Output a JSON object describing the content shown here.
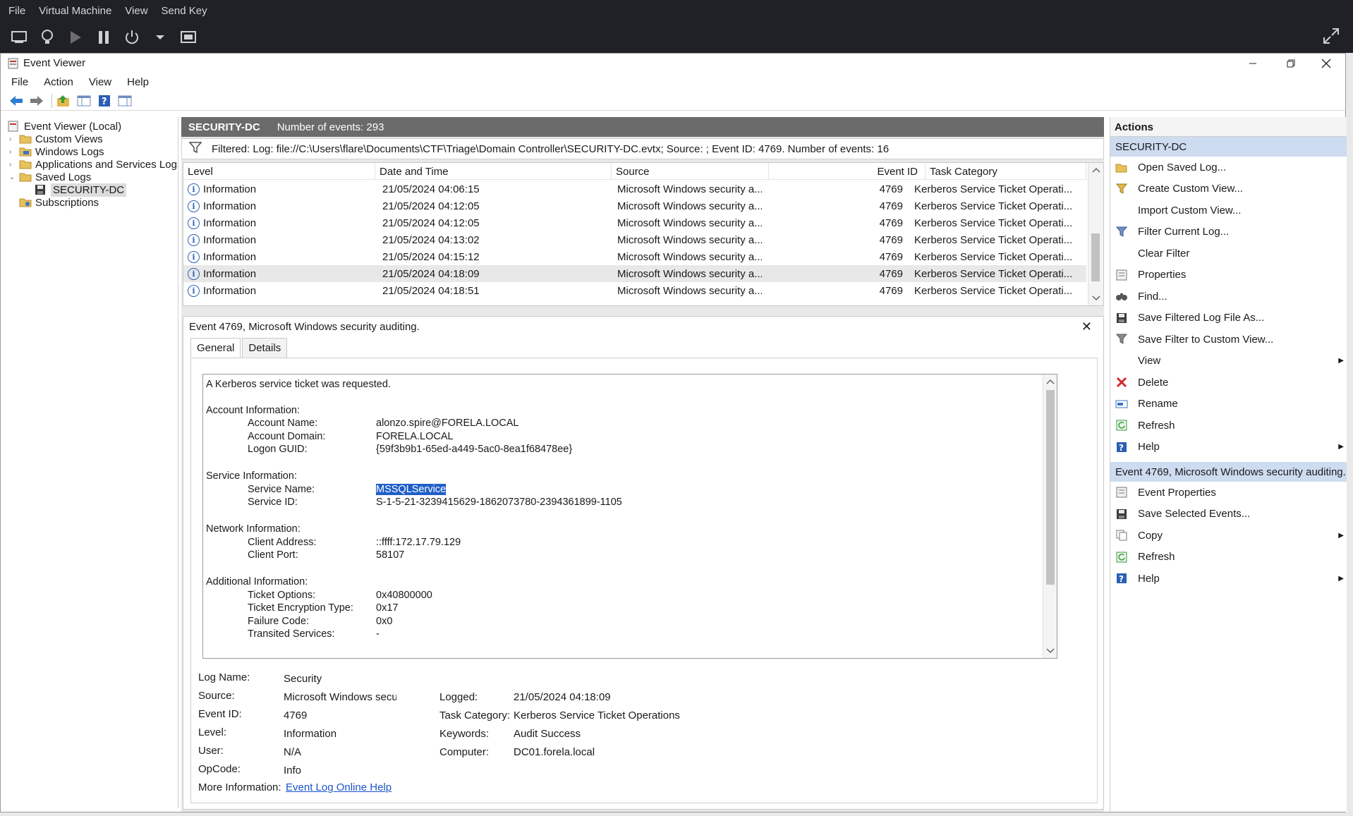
{
  "vm": {
    "menu": [
      "File",
      "Virtual Machine",
      "View",
      "Send Key"
    ]
  },
  "window": {
    "title": "Event Viewer",
    "menu": [
      "File",
      "Action",
      "View",
      "Help"
    ]
  },
  "tree": {
    "items": [
      {
        "label": "Event Viewer (Local)"
      },
      {
        "label": "Custom Views"
      },
      {
        "label": "Windows Logs"
      },
      {
        "label": "Applications and Services Logs"
      },
      {
        "label": "Saved Logs"
      },
      {
        "label": "SECURITY-DC"
      },
      {
        "label": "Subscriptions"
      }
    ]
  },
  "pane": {
    "name": "SECURITY-DC",
    "count": "Number of events: 293",
    "filter": "Filtered: Log: file://C:\\Users\\flare\\Documents\\CTF\\Triage\\Domain Controller\\SECURITY-DC.evtx; Source: ; Event ID: 4769. Number of events: 16"
  },
  "grid": {
    "columns": [
      "Level",
      "Date and Time",
      "Source",
      "Event ID",
      "Task Category"
    ],
    "rows": [
      {
        "level": "Information",
        "date": "21/05/2024 04:06:15",
        "source": "Microsoft Windows security a...",
        "id": "4769",
        "cat": "Kerberos Service Ticket Operati..."
      },
      {
        "level": "Information",
        "date": "21/05/2024 04:12:05",
        "source": "Microsoft Windows security a...",
        "id": "4769",
        "cat": "Kerberos Service Ticket Operati..."
      },
      {
        "level": "Information",
        "date": "21/05/2024 04:12:05",
        "source": "Microsoft Windows security a...",
        "id": "4769",
        "cat": "Kerberos Service Ticket Operati..."
      },
      {
        "level": "Information",
        "date": "21/05/2024 04:13:02",
        "source": "Microsoft Windows security a...",
        "id": "4769",
        "cat": "Kerberos Service Ticket Operati..."
      },
      {
        "level": "Information",
        "date": "21/05/2024 04:15:12",
        "source": "Microsoft Windows security a...",
        "id": "4769",
        "cat": "Kerberos Service Ticket Operati..."
      },
      {
        "level": "Information",
        "date": "21/05/2024 04:18:09",
        "source": "Microsoft Windows security a...",
        "id": "4769",
        "cat": "Kerberos Service Ticket Operati..."
      },
      {
        "level": "Information",
        "date": "21/05/2024 04:18:51",
        "source": "Microsoft Windows security a...",
        "id": "4769",
        "cat": "Kerberos Service Ticket Operati..."
      }
    ]
  },
  "detail": {
    "title": "Event 4769, Microsoft Windows security auditing.",
    "tabs": [
      "General",
      "Details"
    ],
    "message": {
      "intro": "A Kerberos service ticket was requested.",
      "account_header": "Account Information:",
      "account_name_label": "Account Name:",
      "account_name": "alonzo.spire@FORELA.LOCAL",
      "account_domain_label": "Account Domain:",
      "account_domain": "FORELA.LOCAL",
      "logon_guid_label": "Logon GUID:",
      "logon_guid": "{59f3b9b1-65ed-a449-5ac0-8ea1f68478ee}",
      "service_header": "Service Information:",
      "service_name_label": "Service Name:",
      "service_name": "MSSQLService",
      "service_id_label": "Service ID:",
      "service_id": "S-1-5-21-3239415629-1862073780-2394361899-1105",
      "network_header": "Network Information:",
      "client_address_label": "Client Address:",
      "client_address": "::ffff:172.17.79.129",
      "client_port_label": "Client Port:",
      "client_port": "58107",
      "additional_header": "Additional Information:",
      "ticket_options_label": "Ticket Options:",
      "ticket_options": "0x40800000",
      "ticket_enc_label": "Ticket Encryption Type:",
      "ticket_enc": "0x17",
      "failure_code_label": "Failure Code:",
      "failure_code": "0x0",
      "transited_label": "Transited Services:",
      "transited": "-"
    },
    "props": {
      "log_name_label": "Log Name:",
      "log_name": "Security",
      "source_label": "Source:",
      "source": "Microsoft Windows security a",
      "event_id_label": "Event ID:",
      "event_id": "4769",
      "level_label": "Level:",
      "level": "Information",
      "user_label": "User:",
      "user": "N/A",
      "opcode_label": "OpCode:",
      "opcode": "Info",
      "more_info_label": "More Information:",
      "more_info": "Event Log Online Help",
      "logged_label": "Logged:",
      "logged": "21/05/2024 04:18:09",
      "task_cat_label": "Task Category:",
      "task_cat": "Kerberos Service Ticket Operations",
      "keywords_label": "Keywords:",
      "keywords": "Audit Success",
      "computer_label": "Computer:",
      "computer": "DC01.forela.local"
    }
  },
  "actions": {
    "header": "Actions",
    "section1": "SECURITY-DC",
    "items1": [
      {
        "label": "Open Saved Log...",
        "icon": "open-folder-icon"
      },
      {
        "label": "Create Custom View...",
        "icon": "filter-create-icon"
      },
      {
        "label": "Import Custom View...",
        "icon": ""
      },
      {
        "label": "Filter Current Log...",
        "icon": "filter-icon"
      },
      {
        "label": "Clear Filter",
        "icon": ""
      },
      {
        "label": "Properties",
        "icon": "properties-icon"
      },
      {
        "label": "Find...",
        "icon": "binoculars-icon"
      },
      {
        "label": "Save Filtered Log File As...",
        "icon": "save-icon"
      },
      {
        "label": "Save Filter to Custom View...",
        "icon": "filter-save-icon"
      },
      {
        "label": "View",
        "icon": "",
        "sub": true
      },
      {
        "label": "Delete",
        "icon": "delete-icon"
      },
      {
        "label": "Rename",
        "icon": "rename-icon"
      },
      {
        "label": "Refresh",
        "icon": "refresh-icon"
      },
      {
        "label": "Help",
        "icon": "help-icon",
        "sub": true
      }
    ],
    "section2": "Event 4769, Microsoft Windows security auditing.",
    "items2": [
      {
        "label": "Event Properties",
        "icon": "event-properties-icon"
      },
      {
        "label": "Save Selected Events...",
        "icon": "save-icon"
      },
      {
        "label": "Copy",
        "icon": "copy-icon",
        "sub": true
      },
      {
        "label": "Refresh",
        "icon": "refresh-icon"
      },
      {
        "label": "Help",
        "icon": "help-icon",
        "sub": true
      }
    ]
  },
  "colors": {
    "accent_selection": "#1f5fc8",
    "section_header": "#cddcf0",
    "pane_header": "#6b6b6b"
  }
}
